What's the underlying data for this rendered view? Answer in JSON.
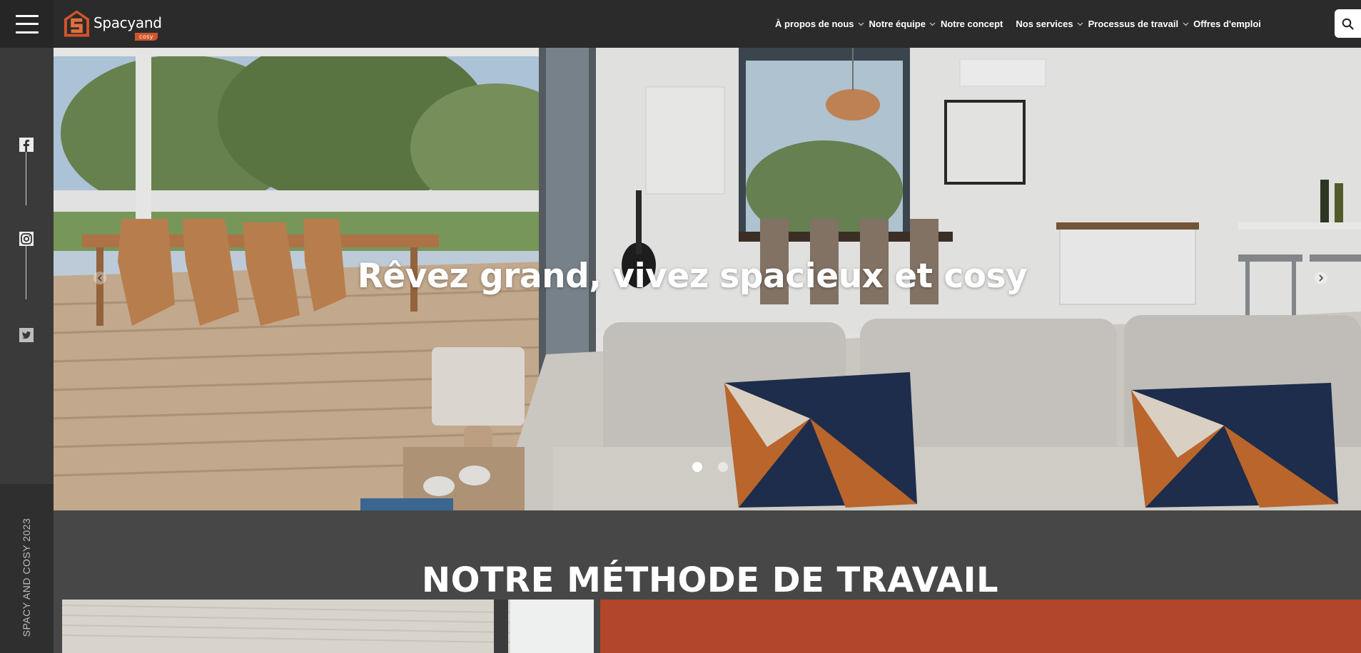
{
  "brand": {
    "name": "Spacyand",
    "tag": "cosy",
    "accent_color": "#d0552b"
  },
  "nav": {
    "items": [
      {
        "label": "À propos de nous",
        "dropdown": true
      },
      {
        "label": "Notre équipe",
        "dropdown": true
      },
      {
        "label": "Notre concept",
        "dropdown": false
      },
      {
        "label": "Nos services",
        "dropdown": true
      },
      {
        "label": "Processus de travail",
        "dropdown": true
      },
      {
        "label": "Offres d'emploi",
        "dropdown": false
      }
    ],
    "search_icon": "search-icon",
    "menu_icon": "hamburger-icon"
  },
  "sidebar": {
    "socials": [
      "facebook-icon",
      "instagram-icon",
      "twitter-icon"
    ],
    "copyright": "SPACY AND COSY 2023"
  },
  "hero": {
    "title": "Rêvez grand, vivez spacieux et cosy",
    "slides_count": 2,
    "active_slide": 1
  },
  "method": {
    "title": "NOTRE MÉTHODE DE TRAVAIL",
    "card_color": "#b2462a"
  }
}
